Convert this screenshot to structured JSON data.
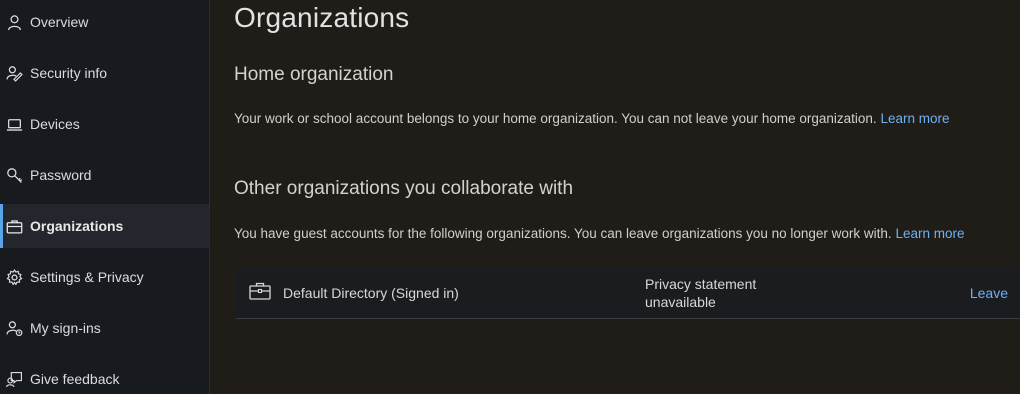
{
  "sidebar": {
    "items": [
      {
        "label": "Overview",
        "icon": "person-icon",
        "active": false
      },
      {
        "label": "Security info",
        "icon": "security-info-icon",
        "active": false
      },
      {
        "label": "Devices",
        "icon": "laptop-icon",
        "active": false
      },
      {
        "label": "Password",
        "icon": "key-icon",
        "active": false
      },
      {
        "label": "Organizations",
        "icon": "briefcase-icon",
        "active": true
      },
      {
        "label": "Settings & Privacy",
        "icon": "gear-icon",
        "active": false
      },
      {
        "label": "My sign-ins",
        "icon": "sign-ins-icon",
        "active": false
      },
      {
        "label": "Give feedback",
        "icon": "feedback-icon",
        "active": false
      }
    ]
  },
  "main": {
    "title": "Organizations",
    "home": {
      "heading": "Home organization",
      "text": "Your work or school account belongs to your home organization. You can not leave your home organization.",
      "link": "Learn more"
    },
    "other": {
      "heading": "Other organizations you collaborate with",
      "text": "You have guest accounts for the following organizations. You can leave organizations you no longer work with.",
      "link": "Learn more",
      "orgs": [
        {
          "name": "Default Directory (Signed in)",
          "privacy_line1": "Privacy statement",
          "privacy_line2": "unavailable",
          "action": "Leave"
        }
      ]
    }
  },
  "colors": {
    "sidebar_bg": "#171a1e",
    "main_bg": "#201d19",
    "accent": "#5aa3e8",
    "link": "#6fb0f0"
  }
}
